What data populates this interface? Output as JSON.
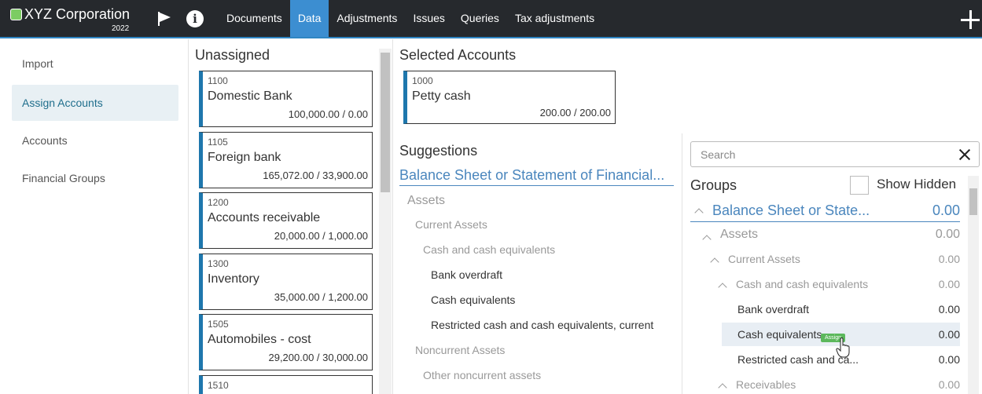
{
  "header": {
    "company": "XYZ Corporation",
    "year": "2022",
    "nav": [
      "Documents",
      "Data",
      "Adjustments",
      "Issues",
      "Queries",
      "Tax adjustments"
    ],
    "active_nav": "Data",
    "accent_color": "#3c8ed1"
  },
  "sidebar": {
    "items": [
      "Import",
      "Assign Accounts",
      "Accounts",
      "Financial Groups"
    ],
    "active": "Assign Accounts"
  },
  "unassigned": {
    "title": "Unassigned",
    "accounts": [
      {
        "number": "1100",
        "name": "Domestic Bank",
        "balance": "100,000.00 / 0.00"
      },
      {
        "number": "1105",
        "name": "Foreign bank",
        "balance": "165,072.00 / 33,900.00"
      },
      {
        "number": "1200",
        "name": "Accounts receivable",
        "balance": "20,000.00 / 1,000.00"
      },
      {
        "number": "1300",
        "name": "Inventory",
        "balance": "35,000.00 / 1,200.00"
      },
      {
        "number": "1505",
        "name": "Automobiles - cost",
        "balance": "29,200.00 / 30,000.00"
      },
      {
        "number": "1510",
        "name": "",
        "balance": ""
      }
    ]
  },
  "selected": {
    "title": "Selected Accounts",
    "account": {
      "number": "1000",
      "name": "Petty cash",
      "balance": "200.00 / 200.00"
    }
  },
  "suggestions": {
    "title": "Suggestions",
    "root": "Balance Sheet or Statement of Financial...",
    "items": [
      "Assets",
      "Current Assets",
      "Cash and cash equivalents",
      "Bank overdraft",
      "Cash equivalents",
      "Restricted cash and cash equivalents, current",
      "Noncurrent Assets",
      "Other noncurrent assets"
    ]
  },
  "groups": {
    "search_placeholder": "Search",
    "title": "Groups",
    "show_hidden_label": "Show Hidden",
    "assign_label": "Assign",
    "rows": [
      {
        "label": "Balance Sheet or State...",
        "amount": "0.00"
      },
      {
        "label": "Assets",
        "amount": "0.00"
      },
      {
        "label": "Current Assets",
        "amount": "0.00"
      },
      {
        "label": "Cash and cash equivalents",
        "amount": "0.00"
      },
      {
        "label": "Bank overdraft",
        "amount": "0.00"
      },
      {
        "label": "Cash equivalents",
        "amount": "0.00"
      },
      {
        "label": "Restricted cash and ca...",
        "amount": "0.00"
      },
      {
        "label": "Receivables",
        "amount": "0.00"
      }
    ]
  }
}
